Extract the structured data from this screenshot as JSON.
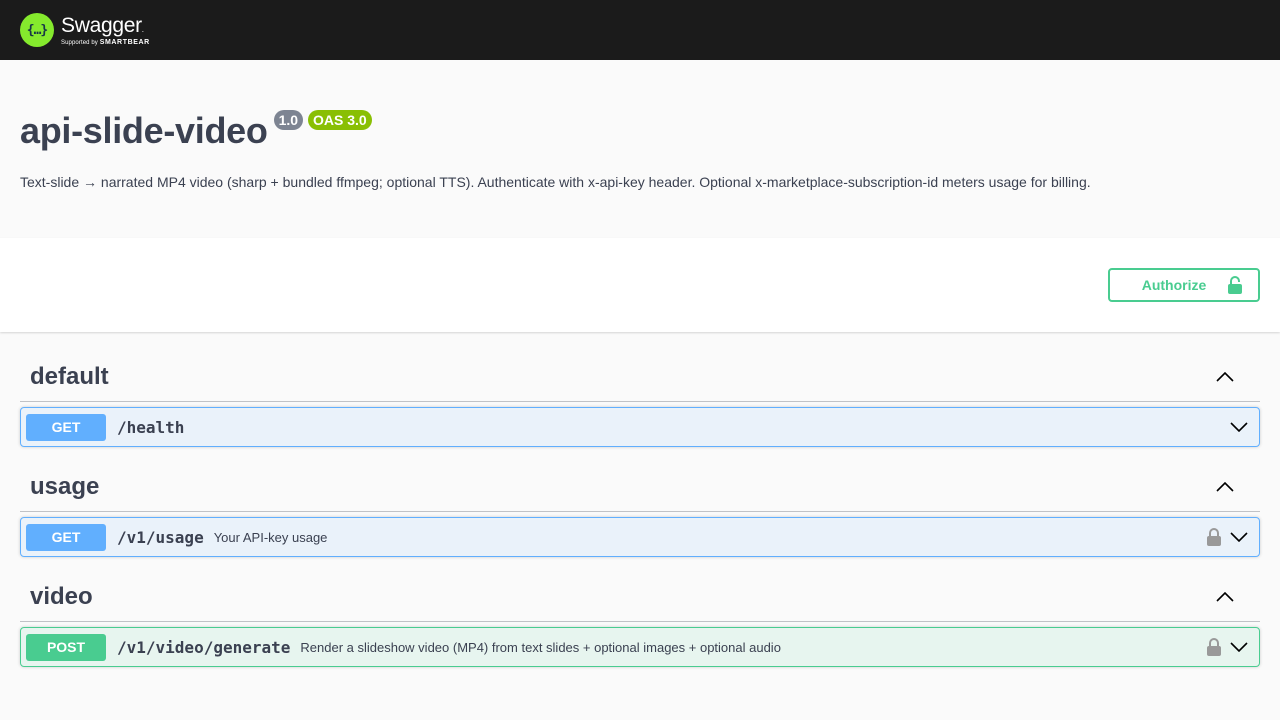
{
  "topbar": {
    "logo_symbol": "{…}",
    "brand": "Swagger",
    "brand_dot": ".",
    "supported_by": "Supported by",
    "supporter": "SMARTBEAR"
  },
  "info": {
    "title": "api-slide-video",
    "version": "1.0",
    "oas": "OAS 3.0",
    "description": "Text-slide → narrated MP4 video (sharp + bundled ffmpeg; optional TTS). Authenticate with x-api-key header. Optional x-marketplace-subscription-id meters usage for billing."
  },
  "scheme": {
    "authorize_label": "Authorize"
  },
  "tags": [
    {
      "name": "default",
      "operations": [
        {
          "method": "GET",
          "path": "/health",
          "summary": "",
          "locked": false
        }
      ]
    },
    {
      "name": "usage",
      "operations": [
        {
          "method": "GET",
          "path": "/v1/usage",
          "summary": "Your API-key usage",
          "locked": true
        }
      ]
    },
    {
      "name": "video",
      "operations": [
        {
          "method": "POST",
          "path": "/v1/video/generate",
          "summary": "Render a slideshow video (MP4) from text slides + optional images + optional audio",
          "locked": true
        }
      ]
    }
  ],
  "colors": {
    "get": "#61affe",
    "post": "#49cc90",
    "topbar": "#1b1b1b",
    "logo": "#85ea2d"
  },
  "icons": {
    "authorize": "unlocked-lock-icon",
    "tag_toggle": "chevron-up-icon",
    "op_expand": "chevron-down-icon",
    "op_lock": "lock-icon"
  }
}
